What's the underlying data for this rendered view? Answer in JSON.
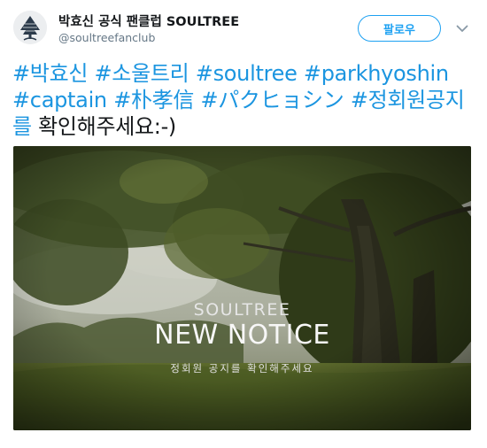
{
  "account": {
    "name": "박효신 공식 팬클럽 SOULTREE",
    "handle": "@soultreefanclub",
    "avatar_icon": "tree-logo-icon"
  },
  "follow_button": {
    "label": "팔로우"
  },
  "more_icon": "chevron-down-icon",
  "tweet": {
    "line1": [
      {
        "text": "#박효신",
        "hashtag": true
      },
      {
        "text": " ",
        "hashtag": false
      },
      {
        "text": "#소울트리",
        "hashtag": true
      },
      {
        "text": " ",
        "hashtag": false
      },
      {
        "text": "#soultree",
        "hashtag": true
      },
      {
        "text": " ",
        "hashtag": false
      },
      {
        "text": "#parkhyoshin",
        "hashtag": true
      }
    ],
    "line2": [
      {
        "text": "#captain",
        "hashtag": true
      },
      {
        "text": " ",
        "hashtag": false
      },
      {
        "text": "#朴孝信",
        "hashtag": true
      },
      {
        "text": " ",
        "hashtag": false
      },
      {
        "text": "#パクヒョシン",
        "hashtag": true
      },
      {
        "text": " ",
        "hashtag": false
      },
      {
        "text": "#정회원공지",
        "hashtag": true
      }
    ],
    "line3": [
      {
        "text": "를",
        "hashtag": true
      },
      {
        "text": " 확인해주세요:-)",
        "hashtag": false
      }
    ]
  },
  "media": {
    "brand": "SOULTREE",
    "title": "NEW NOTICE",
    "subtitle": "정회원 공지를 확인해주세요"
  },
  "colors": {
    "link": "#1b95e0",
    "follow_border": "#1da1f2",
    "handle": "#657786"
  }
}
